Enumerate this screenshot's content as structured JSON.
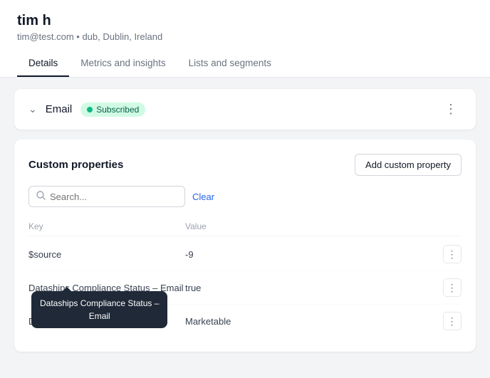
{
  "profile": {
    "name": "tim h",
    "email": "tim@test.com",
    "separator": "•",
    "location": "dub, Dublin, Ireland"
  },
  "tabs": [
    {
      "id": "details",
      "label": "Details",
      "active": true
    },
    {
      "id": "metrics",
      "label": "Metrics and insights",
      "active": false
    },
    {
      "id": "lists",
      "label": "Lists and segments",
      "active": false
    }
  ],
  "email_section": {
    "label": "Email",
    "status": "Subscribed",
    "chevron": "⌄",
    "more_icon": "⋮"
  },
  "custom_properties": {
    "title": "Custom properties",
    "add_button": "Add custom property",
    "search_placeholder": "Search...",
    "clear_label": "Clear",
    "col_key": "Key",
    "col_value": "Value",
    "rows": [
      {
        "key": "$source",
        "value": "-9"
      },
      {
        "key": "Dataships Compliance Status – Email",
        "value": "true",
        "tooltip": "Dataships Compliance Status –\nEmail"
      },
      {
        "key": "Dataships Compliance Statu...",
        "value": "Marketable"
      }
    ],
    "more_icon": "⋮"
  },
  "colors": {
    "active_tab_border": "#111827",
    "badge_bg": "#d1fae5",
    "badge_text": "#065f46",
    "badge_dot": "#10b981",
    "tooltip_bg": "#1f2937"
  }
}
